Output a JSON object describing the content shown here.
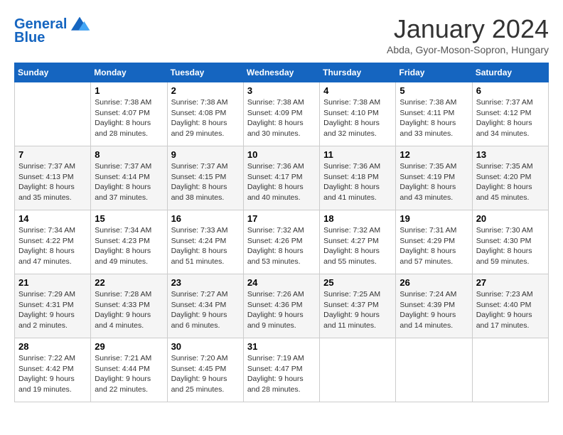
{
  "logo": {
    "text_general": "General",
    "text_blue": "Blue"
  },
  "header": {
    "month_title": "January 2024",
    "subtitle": "Abda, Gyor-Moson-Sopron, Hungary"
  },
  "days_of_week": [
    "Sunday",
    "Monday",
    "Tuesday",
    "Wednesday",
    "Thursday",
    "Friday",
    "Saturday"
  ],
  "weeks": [
    [
      {
        "day": "",
        "info": ""
      },
      {
        "day": "1",
        "sunrise": "7:38 AM",
        "sunset": "4:07 PM",
        "daylight": "8 hours and 28 minutes."
      },
      {
        "day": "2",
        "sunrise": "7:38 AM",
        "sunset": "4:08 PM",
        "daylight": "8 hours and 29 minutes."
      },
      {
        "day": "3",
        "sunrise": "7:38 AM",
        "sunset": "4:09 PM",
        "daylight": "8 hours and 30 minutes."
      },
      {
        "day": "4",
        "sunrise": "7:38 AM",
        "sunset": "4:10 PM",
        "daylight": "8 hours and 32 minutes."
      },
      {
        "day": "5",
        "sunrise": "7:38 AM",
        "sunset": "4:11 PM",
        "daylight": "8 hours and 33 minutes."
      },
      {
        "day": "6",
        "sunrise": "7:37 AM",
        "sunset": "4:12 PM",
        "daylight": "8 hours and 34 minutes."
      }
    ],
    [
      {
        "day": "7",
        "sunrise": "7:37 AM",
        "sunset": "4:13 PM",
        "daylight": "8 hours and 35 minutes."
      },
      {
        "day": "8",
        "sunrise": "7:37 AM",
        "sunset": "4:14 PM",
        "daylight": "8 hours and 37 minutes."
      },
      {
        "day": "9",
        "sunrise": "7:37 AM",
        "sunset": "4:15 PM",
        "daylight": "8 hours and 38 minutes."
      },
      {
        "day": "10",
        "sunrise": "7:36 AM",
        "sunset": "4:17 PM",
        "daylight": "8 hours and 40 minutes."
      },
      {
        "day": "11",
        "sunrise": "7:36 AM",
        "sunset": "4:18 PM",
        "daylight": "8 hours and 41 minutes."
      },
      {
        "day": "12",
        "sunrise": "7:35 AM",
        "sunset": "4:19 PM",
        "daylight": "8 hours and 43 minutes."
      },
      {
        "day": "13",
        "sunrise": "7:35 AM",
        "sunset": "4:20 PM",
        "daylight": "8 hours and 45 minutes."
      }
    ],
    [
      {
        "day": "14",
        "sunrise": "7:34 AM",
        "sunset": "4:22 PM",
        "daylight": "8 hours and 47 minutes."
      },
      {
        "day": "15",
        "sunrise": "7:34 AM",
        "sunset": "4:23 PM",
        "daylight": "8 hours and 49 minutes."
      },
      {
        "day": "16",
        "sunrise": "7:33 AM",
        "sunset": "4:24 PM",
        "daylight": "8 hours and 51 minutes."
      },
      {
        "day": "17",
        "sunrise": "7:32 AM",
        "sunset": "4:26 PM",
        "daylight": "8 hours and 53 minutes."
      },
      {
        "day": "18",
        "sunrise": "7:32 AM",
        "sunset": "4:27 PM",
        "daylight": "8 hours and 55 minutes."
      },
      {
        "day": "19",
        "sunrise": "7:31 AM",
        "sunset": "4:29 PM",
        "daylight": "8 hours and 57 minutes."
      },
      {
        "day": "20",
        "sunrise": "7:30 AM",
        "sunset": "4:30 PM",
        "daylight": "8 hours and 59 minutes."
      }
    ],
    [
      {
        "day": "21",
        "sunrise": "7:29 AM",
        "sunset": "4:31 PM",
        "daylight": "9 hours and 2 minutes."
      },
      {
        "day": "22",
        "sunrise": "7:28 AM",
        "sunset": "4:33 PM",
        "daylight": "9 hours and 4 minutes."
      },
      {
        "day": "23",
        "sunrise": "7:27 AM",
        "sunset": "4:34 PM",
        "daylight": "9 hours and 6 minutes."
      },
      {
        "day": "24",
        "sunrise": "7:26 AM",
        "sunset": "4:36 PM",
        "daylight": "9 hours and 9 minutes."
      },
      {
        "day": "25",
        "sunrise": "7:25 AM",
        "sunset": "4:37 PM",
        "daylight": "9 hours and 11 minutes."
      },
      {
        "day": "26",
        "sunrise": "7:24 AM",
        "sunset": "4:39 PM",
        "daylight": "9 hours and 14 minutes."
      },
      {
        "day": "27",
        "sunrise": "7:23 AM",
        "sunset": "4:40 PM",
        "daylight": "9 hours and 17 minutes."
      }
    ],
    [
      {
        "day": "28",
        "sunrise": "7:22 AM",
        "sunset": "4:42 PM",
        "daylight": "9 hours and 19 minutes."
      },
      {
        "day": "29",
        "sunrise": "7:21 AM",
        "sunset": "4:44 PM",
        "daylight": "9 hours and 22 minutes."
      },
      {
        "day": "30",
        "sunrise": "7:20 AM",
        "sunset": "4:45 PM",
        "daylight": "9 hours and 25 minutes."
      },
      {
        "day": "31",
        "sunrise": "7:19 AM",
        "sunset": "4:47 PM",
        "daylight": "9 hours and 28 minutes."
      },
      {
        "day": "",
        "info": ""
      },
      {
        "day": "",
        "info": ""
      },
      {
        "day": "",
        "info": ""
      }
    ]
  ],
  "labels": {
    "sunrise": "Sunrise:",
    "sunset": "Sunset:",
    "daylight": "Daylight:"
  }
}
